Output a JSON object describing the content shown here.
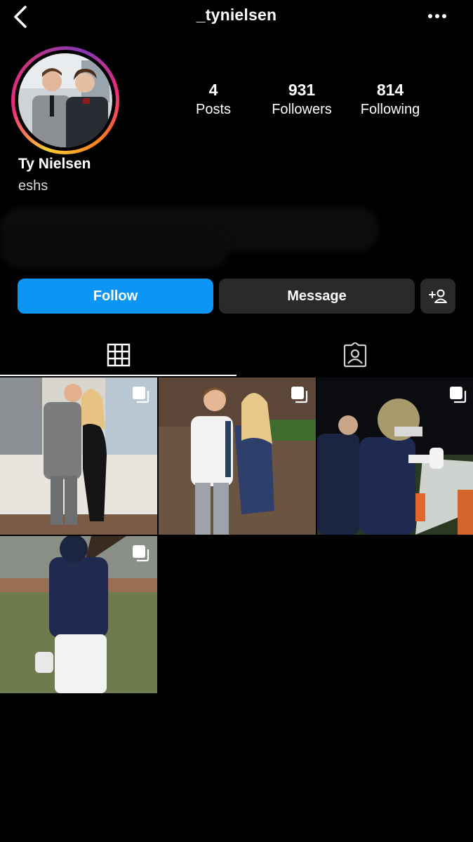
{
  "header": {
    "username": "_tynielsen"
  },
  "profile": {
    "display_name": "Ty Nielsen",
    "bio": "eshs",
    "stats": [
      {
        "value": "4",
        "label": "Posts"
      },
      {
        "value": "931",
        "label": "Followers"
      },
      {
        "value": "814",
        "label": "Following"
      }
    ]
  },
  "actions": {
    "follow": "Follow",
    "message": "Message"
  },
  "tabs": [
    "grid-icon",
    "tagged-icon"
  ],
  "colors": {
    "follow_blue": "#0a95f7",
    "button_gray": "#2a2a2a",
    "background": "#000000"
  }
}
